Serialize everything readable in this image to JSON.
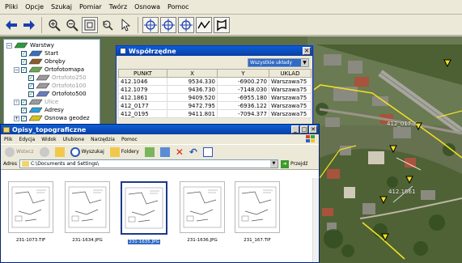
{
  "menu": [
    "Pliki",
    "Opcje",
    "Szukaj",
    "Pomiar",
    "Twórz",
    "Osnowa",
    "Pomoc"
  ],
  "toolbar_icons": [
    "back-arrow-icon",
    "forward-arrow-icon",
    "zoom-in-icon",
    "zoom-out-icon",
    "zoom-extent-icon",
    "zoom-previous-icon",
    "select-pointer-icon",
    "crosshair-icon",
    "crosshair-plus-icon",
    "crosshair-minus-icon",
    "polyline-icon",
    "polygon-icon"
  ],
  "layers": [
    {
      "label": "Warstwy",
      "level": 0,
      "expander": "−",
      "checked": null,
      "dim": false
    },
    {
      "label": "Start",
      "level": 1,
      "expander": "",
      "checked": true,
      "dim": false
    },
    {
      "label": "Obręby",
      "level": 1,
      "expander": "",
      "checked": true,
      "dim": false
    },
    {
      "label": "Ortofotomapa",
      "level": 1,
      "expander": "−",
      "checked": true,
      "dim": false
    },
    {
      "label": "Ortofoto250",
      "level": 2,
      "expander": "",
      "checked": true,
      "dim": true
    },
    {
      "label": "Ortofoto100",
      "level": 2,
      "expander": "",
      "checked": true,
      "dim": true
    },
    {
      "label": "Ortofoto500",
      "level": 2,
      "expander": "",
      "checked": true,
      "dim": false
    },
    {
      "label": "Ulice",
      "level": 1,
      "expander": "+",
      "checked": true,
      "dim": true
    },
    {
      "label": "Adresy",
      "level": 1,
      "expander": "",
      "checked": true,
      "dim": false
    },
    {
      "label": "Osnowa geodez",
      "level": 1,
      "expander": "+",
      "checked": true,
      "dim": false
    }
  ],
  "coordinates": {
    "title": "Współrzędne",
    "filter": "Wszystkie układy",
    "columns": [
      "PUNKT",
      "X",
      "Y",
      "UKLAD"
    ],
    "rows": [
      [
        "412.1046",
        "9534.330",
        "-6900.270",
        "Warszawa75"
      ],
      [
        "412.1079",
        "9436.730",
        "-7148.030",
        "Warszawa75"
      ],
      [
        "412.1861",
        "9409.520",
        "-6955.180",
        "Warszawa75"
      ],
      [
        "412_0177",
        "9472.795",
        "-6936.122",
        "Warszawa75"
      ],
      [
        "412_0195",
        "9411.801",
        "-7094.377",
        "Warszawa75"
      ]
    ]
  },
  "map_labels": [
    "412_017 X",
    "412.1661"
  ],
  "explorer": {
    "title": "Opisy_topograficzne",
    "menu": [
      "Plik",
      "Edycja",
      "Widok",
      "Ulubione",
      "Narzędzia",
      "Pomoc"
    ],
    "back_label": "Wstecz",
    "search_label": "Wyszukaj",
    "folders_label": "Foldery",
    "address_label": "Adres",
    "address": "C:\\Documents and Settings\\",
    "go_label": "Przejdź",
    "files": [
      {
        "name": "231-1073.TIF",
        "selected": false
      },
      {
        "name": "231-1634.JPG",
        "selected": false
      },
      {
        "name": "231-1635.JPG",
        "selected": true
      },
      {
        "name": "231-1636.JPG",
        "selected": false
      },
      {
        "name": "231_167.TIF",
        "selected": false
      }
    ]
  },
  "colors": {
    "boundary": "#f0e020",
    "title_bar": "#0b3ea4",
    "selection": "#316ac5"
  }
}
